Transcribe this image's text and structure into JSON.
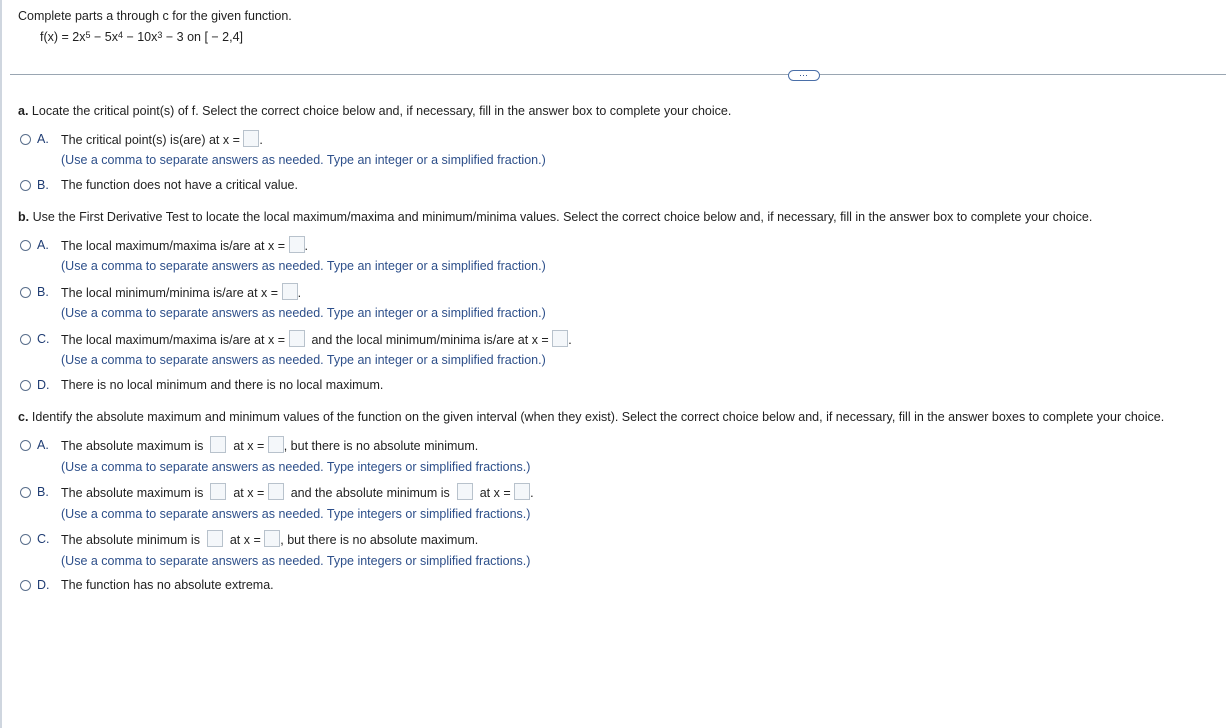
{
  "instructions": "Complete parts a through c for the given function.",
  "function": {
    "prefix": "f(x) = 2x",
    "exp5": "5",
    "mid1": " − 5x",
    "exp4": "4",
    "mid2": " − 10x",
    "exp3": "3",
    "suffix": " − 3 on [ − 2,4]"
  },
  "more_button": "⋯",
  "part_a": {
    "question": "Locate the critical point(s) of f. Select the correct choice below and, if necessary, fill in the answer box to complete your choice.",
    "label": "a.",
    "A": {
      "letter": "A.",
      "text1": "The critical point(s) is(are) at x =",
      "hint": "(Use a comma to separate answers as needed. Type an integer or a simplified fraction.)"
    },
    "B": {
      "letter": "B.",
      "text1": "The function does not have a critical value."
    }
  },
  "part_b": {
    "label": "b.",
    "question": "Use the First Derivative Test to locate the local maximum/maxima and minimum/minima values. Select the correct choice below and, if necessary, fill in the answer box to complete your choice.",
    "A": {
      "letter": "A.",
      "text1": "The local maximum/maxima is/are at x =",
      "hint": "(Use a comma to separate answers as needed. Type an integer or a simplified fraction.)"
    },
    "B": {
      "letter": "B.",
      "text1": "The local minimum/minima is/are at x =",
      "hint": "(Use a comma to separate answers as needed. Type an integer or a simplified fraction.)"
    },
    "C": {
      "letter": "C.",
      "text1": "The local maximum/maxima is/are at x =",
      "text2": "and the local minimum/minima is/are at x =",
      "hint": "(Use a comma to separate answers as needed. Type an integer or a simplified fraction.)"
    },
    "D": {
      "letter": "D.",
      "text1": "There is no local minimum and there is no local maximum."
    }
  },
  "part_c": {
    "label": "c.",
    "question": "Identify the absolute maximum and minimum values of the function on the given interval (when they exist). Select the correct choice below and, if necessary, fill in the answer boxes to complete your choice.",
    "A": {
      "letter": "A.",
      "text1": "The absolute maximum is",
      "text2": "at x =",
      "text3": ", but there is no absolute minimum.",
      "hint": "(Use a comma to separate answers as needed. Type integers or simplified fractions.)"
    },
    "B": {
      "letter": "B.",
      "text1": "The absolute maximum is",
      "text2": "at x =",
      "text3": "and the absolute minimum is",
      "text4": "at x =",
      "hint": "(Use a comma to separate answers as needed. Type integers or simplified fractions.)"
    },
    "C": {
      "letter": "C.",
      "text1": "The absolute minimum is",
      "text2": "at x =",
      "text3": ", but there is no absolute maximum.",
      "hint": "(Use a comma to separate answers as needed. Type integers or simplified fractions.)"
    },
    "D": {
      "letter": "D.",
      "text1": "The function has no absolute extrema."
    }
  },
  "colors": {
    "option_letter": "#1f3c73",
    "hint": "#2d4f8a",
    "divider": "#9aa6b2",
    "input_bg": "#f4f7fa"
  }
}
